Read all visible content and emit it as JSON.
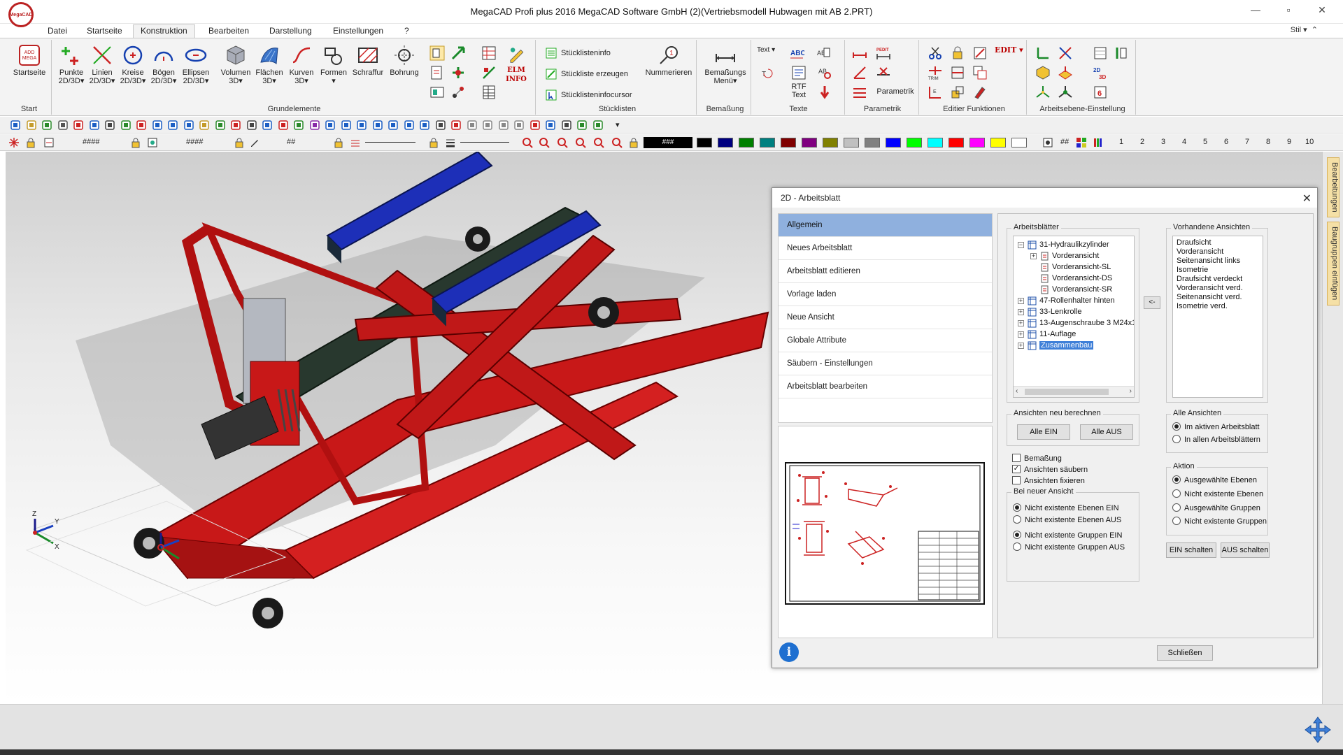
{
  "window": {
    "title": "MegaCAD Profi plus 2016  MegaCAD Software GmbH (2)(Vertriebsmodell Hubwagen mit AB 2.PRT)",
    "logo_text": "MegaCAD",
    "minimize": "—",
    "maximize": "▫",
    "close": "✕"
  },
  "menu": {
    "tabs": [
      "Datei",
      "Startseite",
      "Konstruktion",
      "Bearbeiten",
      "Darstellung",
      "Einstellungen",
      "?"
    ],
    "active": "Konstruktion",
    "style_label": "Stil"
  },
  "ribbon": {
    "start": {
      "label": "Start",
      "button": "Startseite"
    },
    "grundelemente": {
      "label": "Grundelemente",
      "buttons": [
        [
          "Punkte",
          "2D/3D"
        ],
        [
          "Linien",
          "2D/3D"
        ],
        [
          "Kreise",
          "2D/3D"
        ],
        [
          "Bögen",
          "2D/3D"
        ],
        [
          "Ellipsen",
          "2D/3D"
        ],
        [
          "Volumen",
          "3D"
        ],
        [
          "Flächen",
          "3D"
        ],
        [
          "Kurven",
          "3D"
        ],
        [
          "Formen",
          ""
        ],
        [
          "Schraffur",
          ""
        ],
        [
          "Bohrung",
          ""
        ]
      ],
      "elm_info": "ELM INFO"
    },
    "stuecklisten": {
      "label": "Stücklisten",
      "items": [
        "Stücklisteninfo",
        "Stückliste erzeugen",
        "Stücklisteninfocursor"
      ],
      "nummerieren": "Nummerieren"
    },
    "bemassung": {
      "label": "Bemaßung",
      "button": "Bemaßungs Menü",
      "badge": "15"
    },
    "texte": {
      "label": "Texte",
      "text_drop": "Text",
      "rtf": "RTF Text"
    },
    "parametrik": {
      "label": "Parametrik",
      "button": "Parametrik",
      "pedit": "PEDIT"
    },
    "editier": {
      "label": "Editier Funktionen",
      "edit": "EDIT",
      "trim": "TRIM"
    },
    "arbeitsebene": {
      "label": "Arbeitsebene-Einstellung",
      "badge": "2D 3D"
    }
  },
  "toolbar2": {
    "hash1": "####",
    "hash2": "####",
    "hash3": "##",
    "hash4": "###",
    "hash5": "##",
    "numbers": [
      "1",
      "2",
      "3",
      "4",
      "5",
      "6",
      "7",
      "8",
      "9",
      "10"
    ],
    "colors": [
      "#000000",
      "#000080",
      "#008000",
      "#008080",
      "#800000",
      "#800080",
      "#808000",
      "#c0c0c0",
      "#808080",
      "#0000ff",
      "#00ff00",
      "#00ffff",
      "#ff0000",
      "#ff00ff",
      "#ffff00",
      "#ffffff"
    ]
  },
  "side_tabs": [
    "Bearbeitungen",
    "Baugruppen einfügen"
  ],
  "dialog": {
    "title": "2D - Arbeitsblatt",
    "close": "✕",
    "nav": [
      "Allgemein",
      "Neues Arbeitsblatt",
      "Arbeitsblatt editieren",
      "Vorlage laden",
      "Neue Ansicht",
      "Globale Attribute",
      "Säubern - Einstellungen",
      "Arbeitsblatt bearbeiten"
    ],
    "arbeitsblaetter": {
      "label": "Arbeitsblätter",
      "tree": [
        {
          "text": "31-Hydraulikzylinder",
          "level": 0,
          "box": "⊟",
          "type": "sheet"
        },
        {
          "text": "Vorderansicht",
          "level": 1,
          "box": "⊞",
          "type": "view"
        },
        {
          "text": "Vorderansicht-SL",
          "level": 1,
          "box": "",
          "type": "view"
        },
        {
          "text": "Vorderansicht-DS",
          "level": 1,
          "box": "",
          "type": "view"
        },
        {
          "text": "Vorderansicht-SR",
          "level": 1,
          "box": "",
          "type": "view"
        },
        {
          "text": "47-Rollenhalter hinten",
          "level": 0,
          "box": "⊞",
          "type": "sheet"
        },
        {
          "text": "33-Lenkrolle",
          "level": 0,
          "box": "⊞",
          "type": "sheet"
        },
        {
          "text": "13-Augenschraube 3 M24x140",
          "level": 0,
          "box": "⊞",
          "type": "sheet"
        },
        {
          "text": "11-Auflage",
          "level": 0,
          "box": "⊞",
          "type": "sheet"
        },
        {
          "text": "Zusammenbau",
          "level": 0,
          "box": "⊞",
          "type": "sheet",
          "selected": true
        }
      ]
    },
    "arrow_btn": "<-",
    "vorhandene": {
      "label": "Vorhandene Ansichten",
      "items": [
        "Draufsicht",
        "Vorderansicht",
        "Seitenansicht links",
        "Isometrie",
        "Draufsicht verdeckt",
        "Vorderansicht verd.",
        "Seitenansicht verd.",
        "Isometrie verd."
      ]
    },
    "neu_berechnen": {
      "label": "Ansichten neu berechnen",
      "ein": "Alle EIN",
      "aus": "Alle AUS"
    },
    "alle_ansichten": {
      "label": "Alle Ansichten",
      "options": [
        "Im aktiven Arbeitsblatt",
        "In allen Arbeitsblättern"
      ],
      "selected": 0
    },
    "checks": [
      {
        "label": "Bemaßung",
        "checked": false
      },
      {
        "label": "Ansichten säubern",
        "checked": true
      },
      {
        "label": "Ansichten fixieren",
        "checked": false
      }
    ],
    "bei_neuer": {
      "label": "Bei neuer Ansicht",
      "options": [
        "Nicht existente Ebenen EIN",
        "Nicht existente Ebenen AUS",
        "Nicht existente Gruppen EIN",
        "Nicht existente Gruppen AUS"
      ],
      "selected": [
        0,
        2
      ]
    },
    "aktion": {
      "label": "Aktion",
      "options": [
        "Ausgewählte Ebenen",
        "Nicht existente Ebenen",
        "Ausgewählte Gruppen",
        "Nicht existente Gruppen"
      ],
      "selected": 0,
      "ein": "EIN schalten",
      "aus": "AUS schalten"
    },
    "info": "i",
    "schliessen": "Schließen"
  },
  "viewport": {
    "axes": [
      "X",
      "Y",
      "Z"
    ]
  }
}
